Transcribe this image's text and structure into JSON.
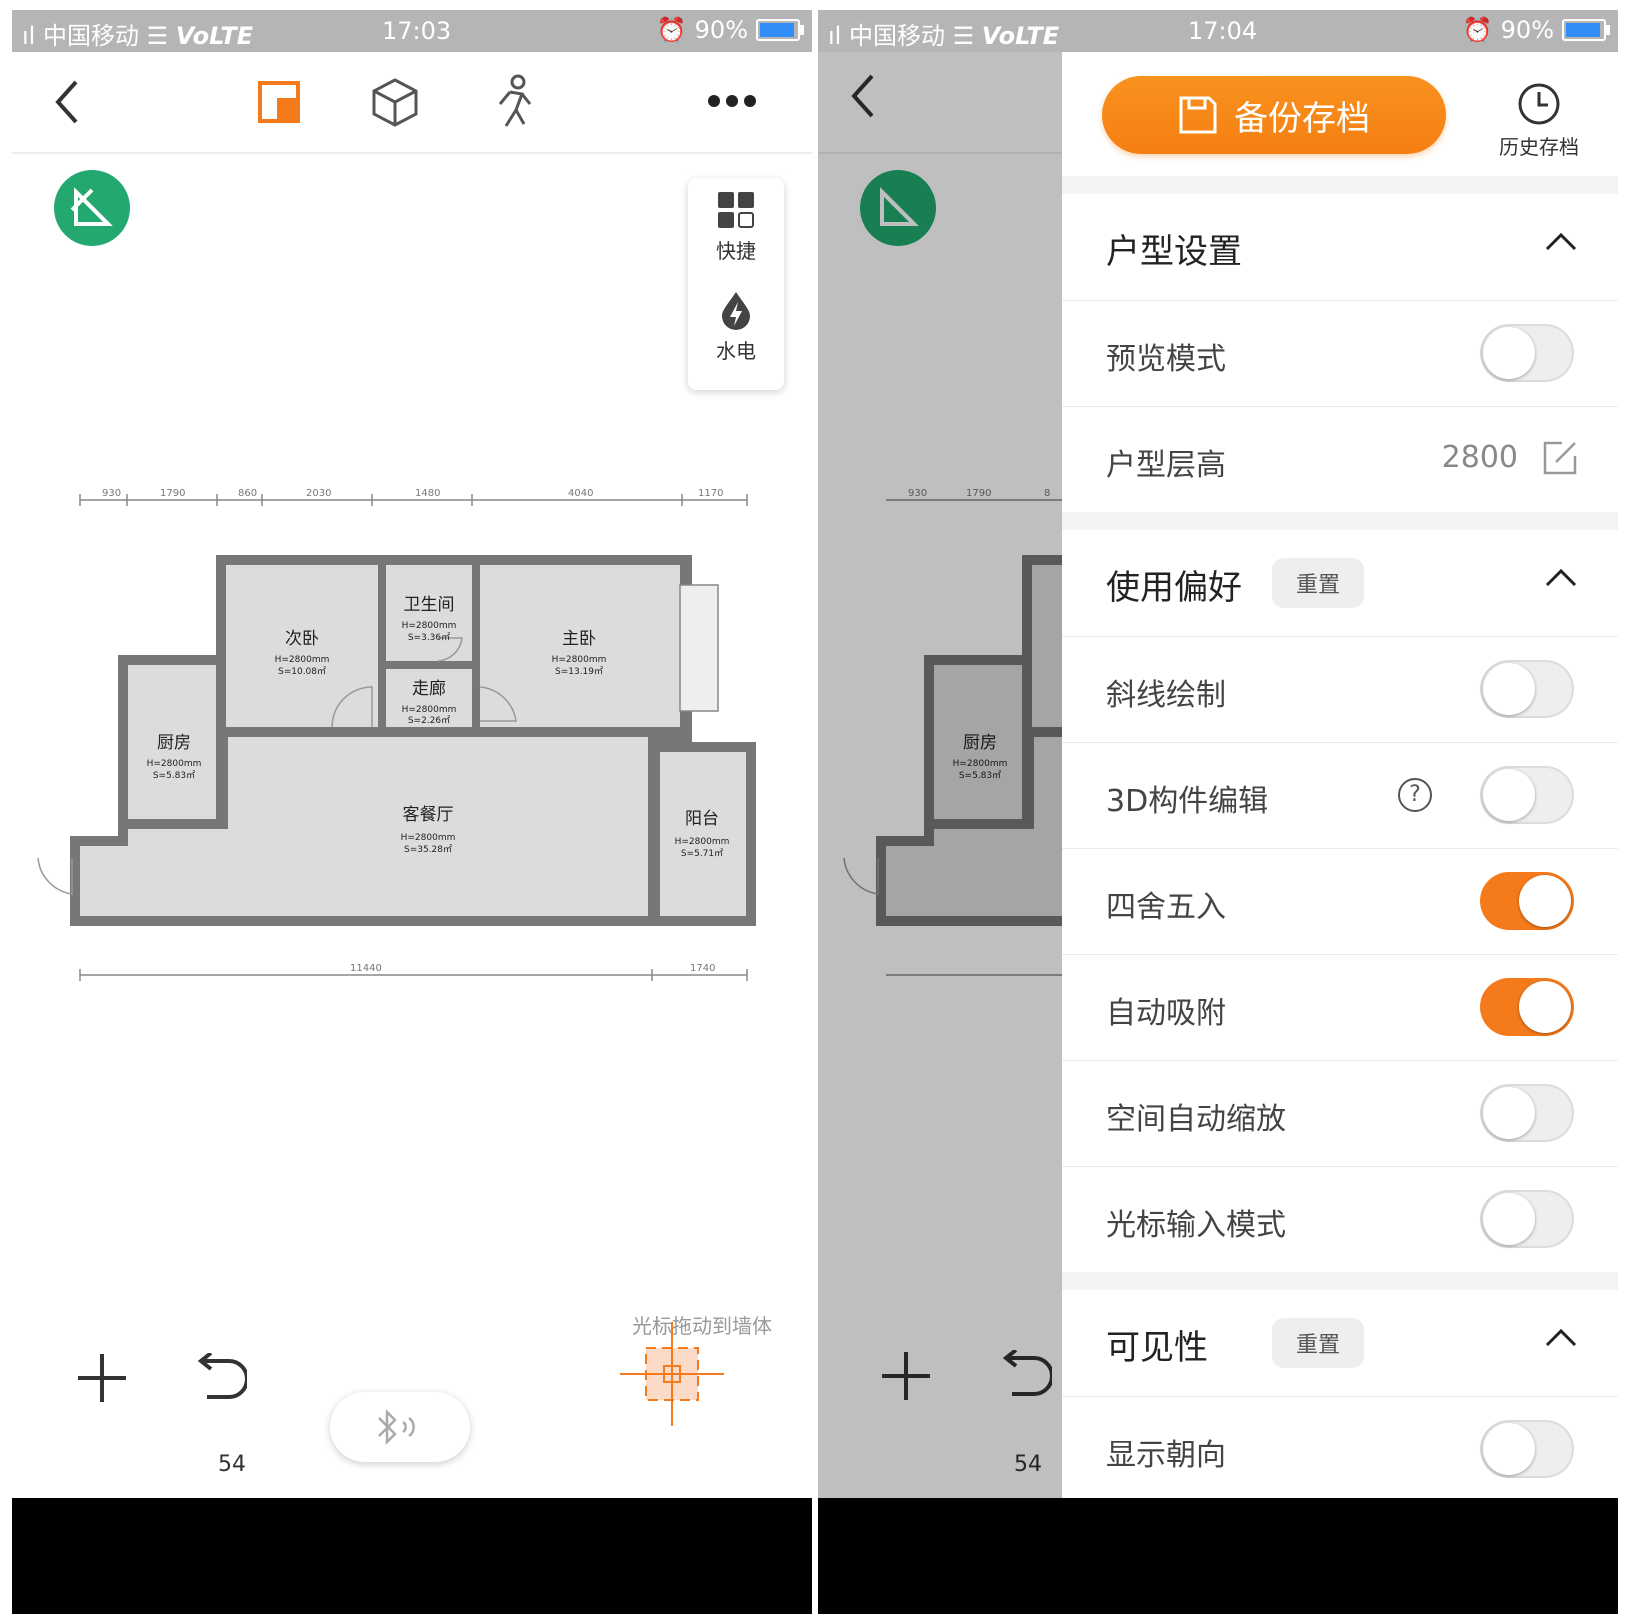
{
  "status_left": {
    "carrier": "中国移动",
    "network": "VoLTE",
    "time": "17:03",
    "battery": "90%"
  },
  "status_right": {
    "carrier": "中国移动",
    "network": "VoLTE",
    "time": "17:04",
    "battery": "90%"
  },
  "quick_panel": {
    "shortcut_label": "快捷",
    "utility_label": "水电"
  },
  "floorplan": {
    "top_dims": [
      "930",
      "1790",
      "860",
      "2030",
      "1480",
      "4040",
      "1170"
    ],
    "bottom_dims": [
      "11440",
      "1740"
    ],
    "rooms": [
      {
        "name": "次卧",
        "h": "H=2800mm",
        "s": "S=10.08㎡"
      },
      {
        "name": "卫生间",
        "h": "H=2800mm",
        "s": "S=3.36㎡"
      },
      {
        "name": "主卧",
        "h": "H=2800mm",
        "s": "S=13.19㎡"
      },
      {
        "name": "走廊",
        "h": "H=2800mm",
        "s": "S=2.26㎡"
      },
      {
        "name": "厨房",
        "h": "H=2800mm",
        "s": "S=5.83㎡"
      },
      {
        "name": "客餐厅",
        "h": "H=2800mm",
        "s": "S=35.28㎡"
      },
      {
        "name": "阳台",
        "h": "H=2800mm",
        "s": "S=5.71㎡"
      }
    ]
  },
  "bottom": {
    "hint": "光标拖动到墙体",
    "undo_count": "54"
  },
  "overlay_dims": [
    "930",
    "1790",
    "8"
  ],
  "overlay_room": {
    "name": "厨房",
    "h": "H=2800mm",
    "s": "S=5.83㎡"
  },
  "drawer": {
    "backup_label": "备份存档",
    "history_label": "历史存档",
    "section_layout": "户型设置",
    "preview_mode": "预览模式",
    "floor_height_label": "户型层高",
    "floor_height_value": "2800",
    "section_prefs": "使用偏好",
    "reset_label": "重置",
    "diagonal": "斜线绘制",
    "edit3d": "3D构件编辑",
    "rounding": "四舍五入",
    "snap": "自动吸附",
    "autozoom": "空间自动缩放",
    "cursor_input": "光标输入模式",
    "section_visibility": "可见性",
    "show_orientation": "显示朝向"
  },
  "toggles": {
    "preview_mode": false,
    "diagonal": false,
    "edit3d": false,
    "rounding": true,
    "snap": true,
    "autozoom": false,
    "cursor_input": false,
    "show_orientation": false
  },
  "colors": {
    "accent": "#f57a1b",
    "green": "#23a96f",
    "status_bar": "#b5b5b5"
  }
}
